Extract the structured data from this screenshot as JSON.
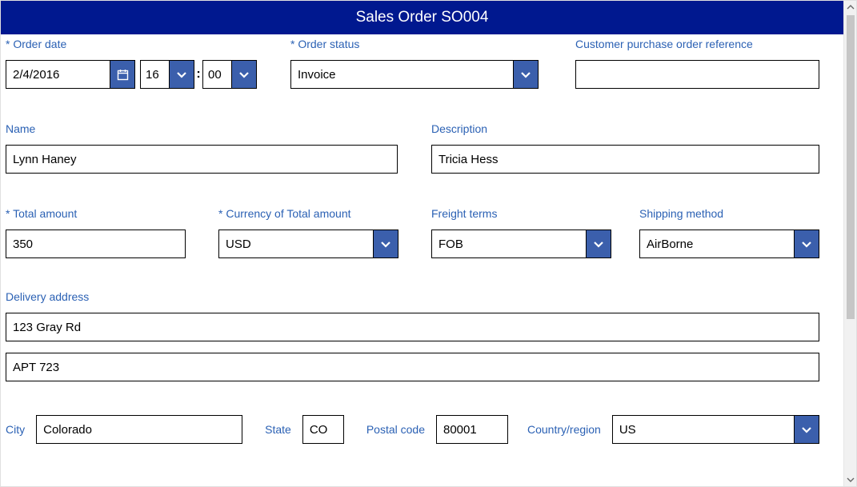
{
  "header": {
    "title": "Sales Order SO004"
  },
  "labels": {
    "order_date": "Order date",
    "order_status": "Order status",
    "customer_po_ref": "Customer purchase order reference",
    "name": "Name",
    "description": "Description",
    "total_amount": "Total amount",
    "currency": "Currency of Total amount",
    "freight_terms": "Freight terms",
    "shipping_method": "Shipping method",
    "delivery_address": "Delivery address",
    "city": "City",
    "state": "State",
    "postal_code": "Postal code",
    "country_region": "Country/region"
  },
  "values": {
    "order_date": "2/4/2016",
    "order_hour": "16",
    "order_min": "00",
    "order_status": "Invoice",
    "customer_po_ref": "",
    "name": "Lynn Haney",
    "description": "Tricia Hess",
    "total_amount": "350",
    "currency": "USD",
    "freight_terms": "FOB",
    "shipping_method": "AirBorne",
    "address_line1": "123 Gray Rd",
    "address_line2": "APT 723",
    "city": "Colorado",
    "state": "CO",
    "postal_code": "80001",
    "country_region": "US"
  }
}
